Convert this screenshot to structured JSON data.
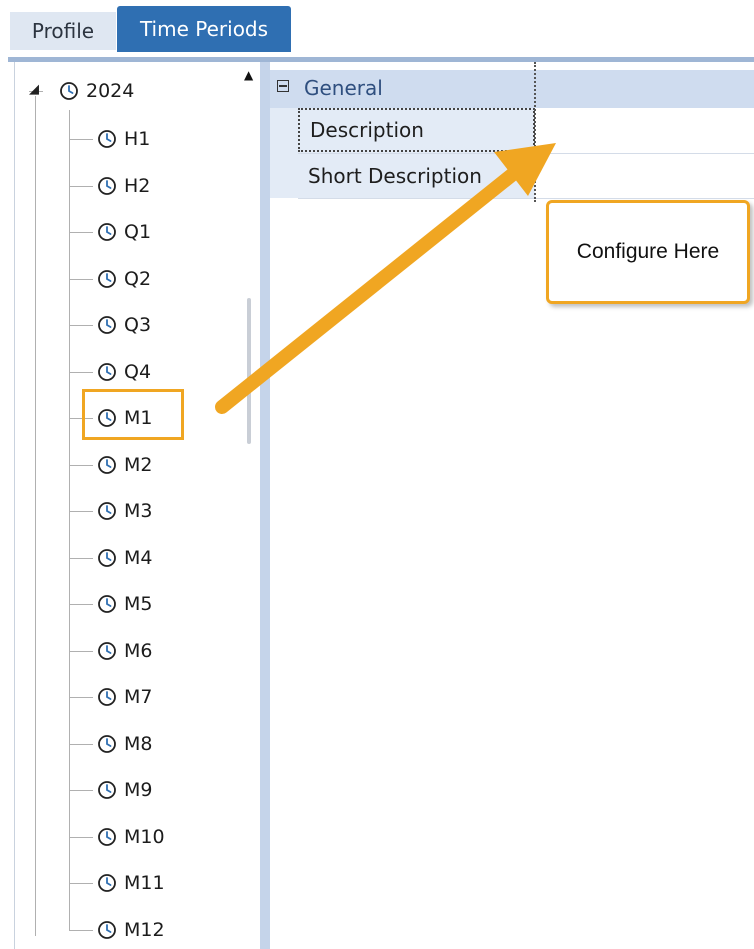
{
  "tabs": [
    {
      "label": "Profile",
      "active": false
    },
    {
      "label": "Time Periods",
      "active": true
    }
  ],
  "tree": {
    "root": {
      "label": "2024",
      "expanded": true
    },
    "children": [
      "H1",
      "H2",
      "Q1",
      "Q2",
      "Q3",
      "Q4",
      "M1",
      "M2",
      "M3",
      "M4",
      "M5",
      "M6",
      "M7",
      "M8",
      "M9",
      "M10",
      "M11",
      "M12"
    ],
    "selected": "M1"
  },
  "grid": {
    "category": "General",
    "properties": [
      "Description",
      "Short Description"
    ]
  },
  "callout": {
    "text": "Configure Here"
  },
  "colors": {
    "accent": "#f0a622",
    "tab_active": "#2f6fb2",
    "category_bg": "#cfdcef"
  }
}
